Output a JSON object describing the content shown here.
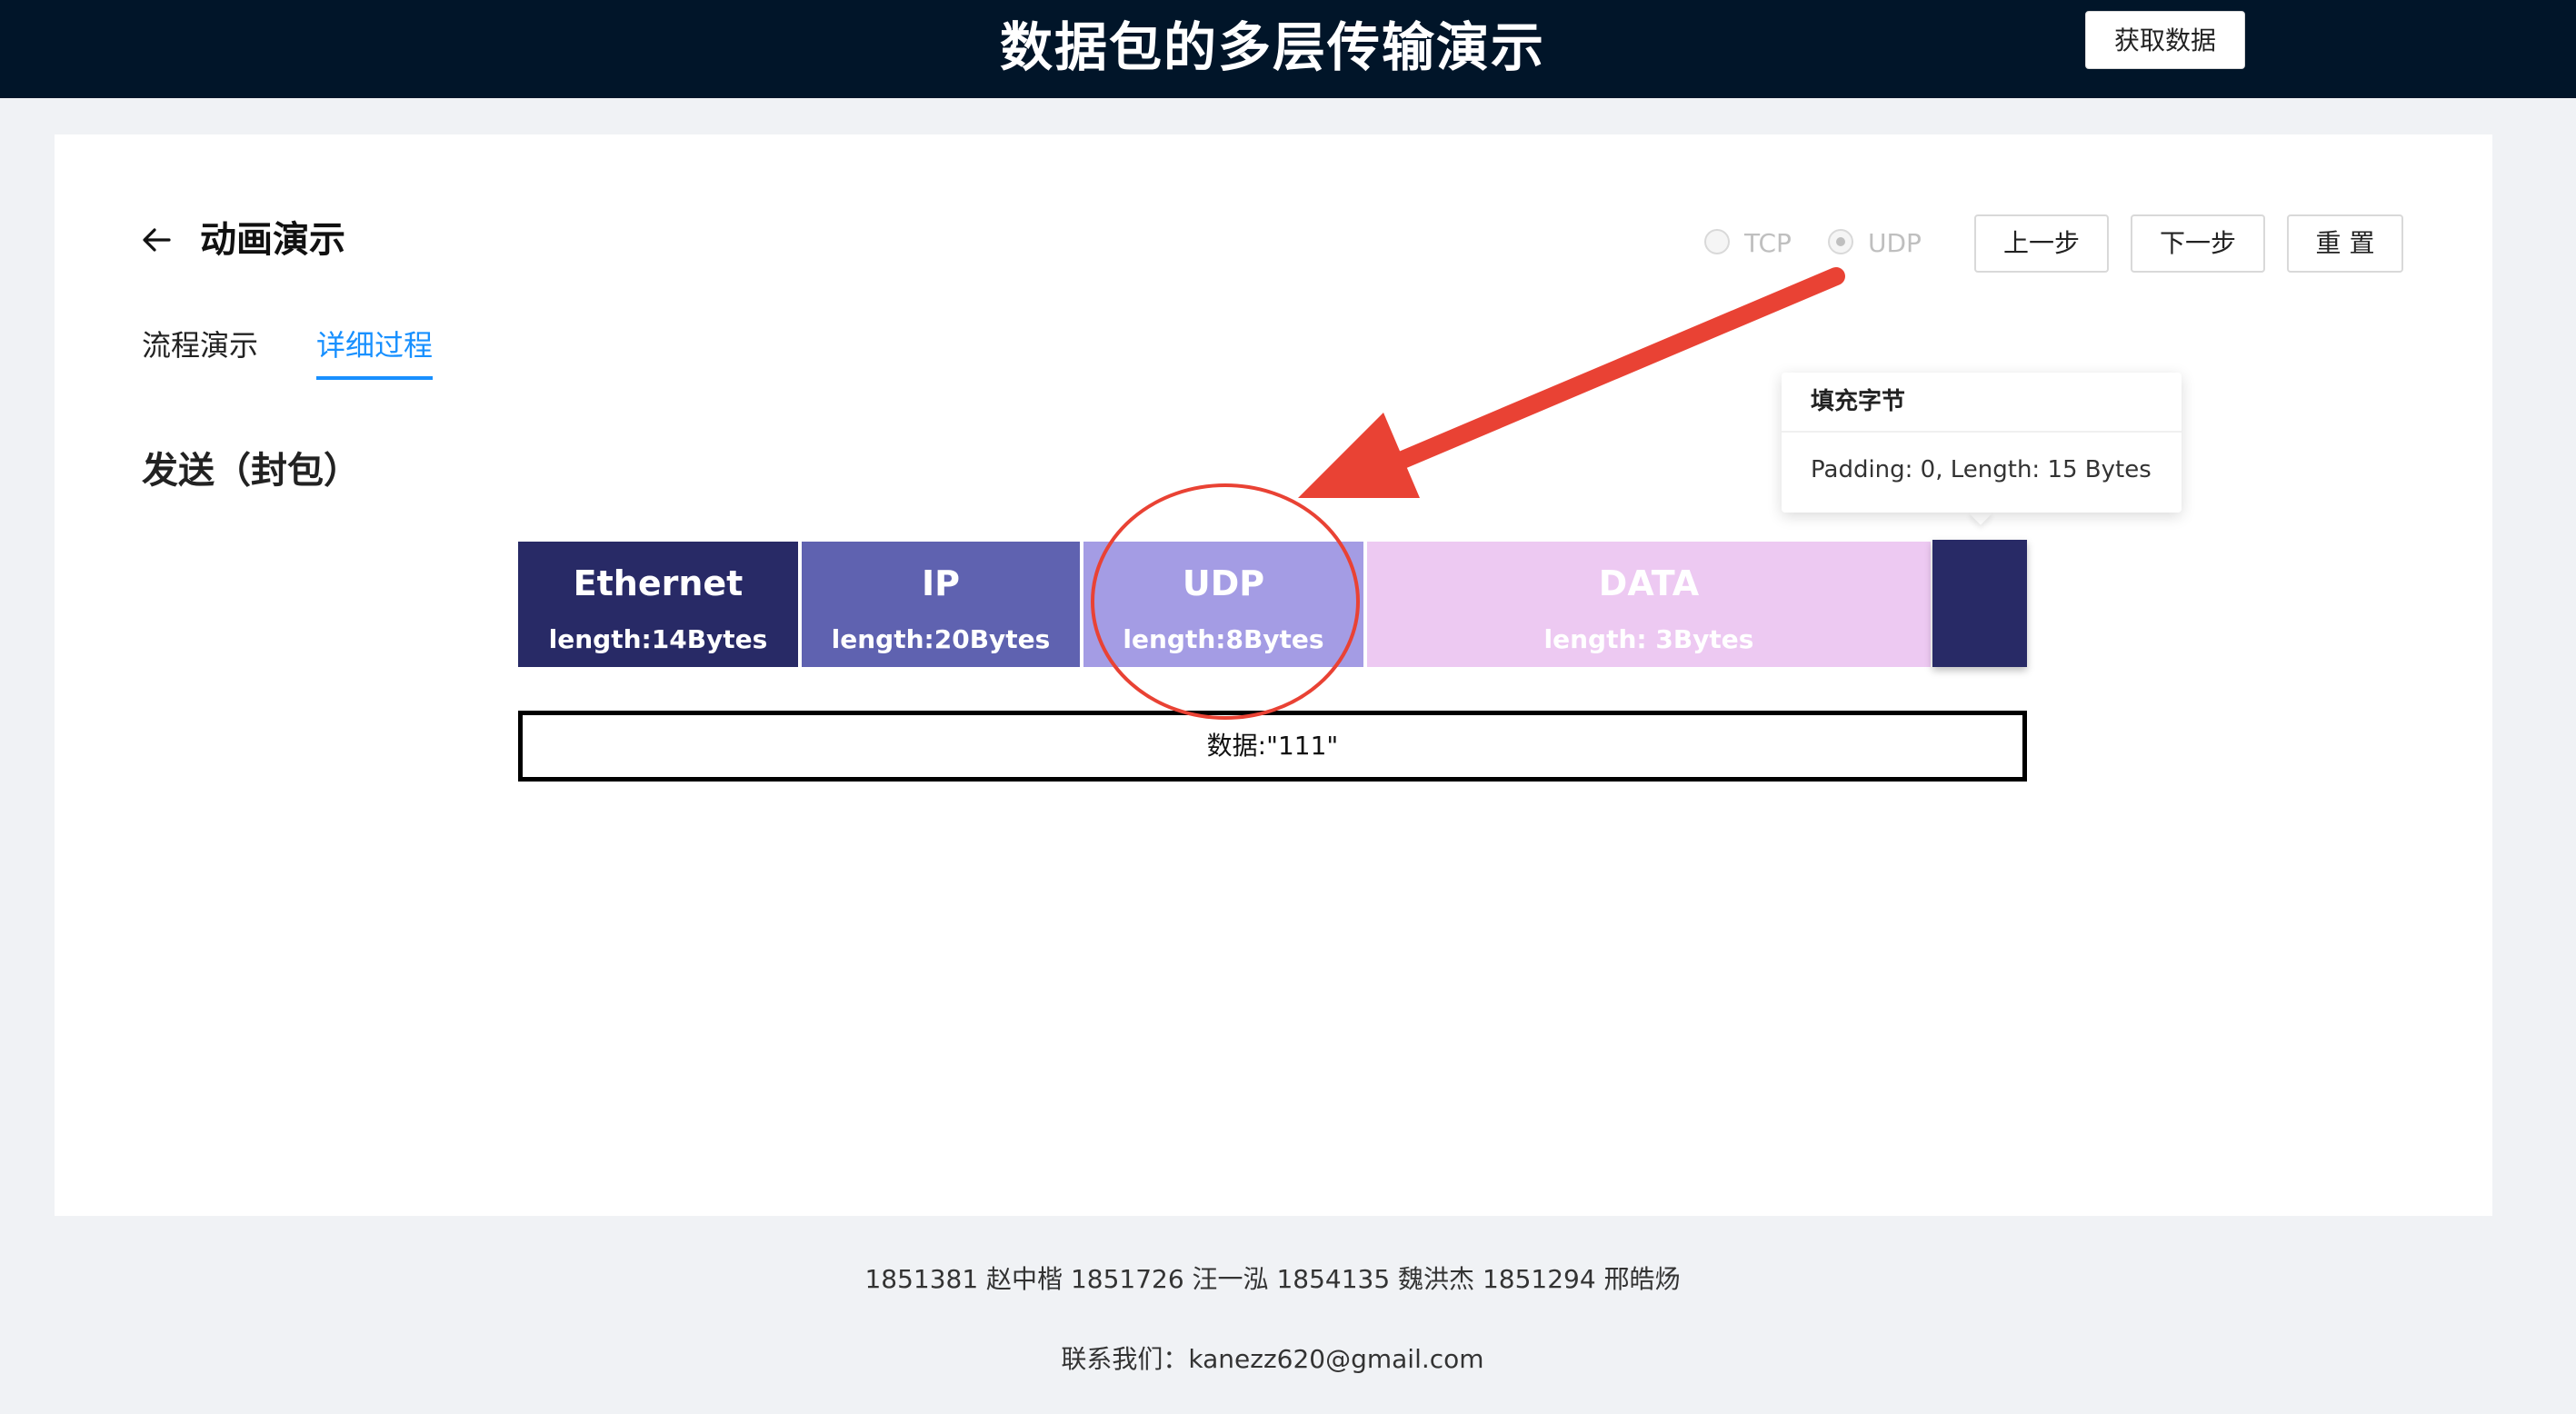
{
  "header": {
    "app_title": "数据包的多层传输演示",
    "fetch_button": "获取数据"
  },
  "card": {
    "title": "动画演示",
    "protocol_options": [
      {
        "label": "TCP",
        "selected": false
      },
      {
        "label": "UDP",
        "selected": true
      }
    ],
    "buttons": {
      "prev": "上一步",
      "next": "下一步",
      "reset": "重 置"
    },
    "tabs": [
      {
        "label": "流程演示",
        "active": false
      },
      {
        "label": "详细过程",
        "active": true
      }
    ],
    "section_title": "发送（封包）",
    "packet_segments": [
      {
        "name": "Ethernet",
        "length": "length:14Bytes",
        "color": "#282a66"
      },
      {
        "name": "IP",
        "length": "length:20Bytes",
        "color": "#5f62b0"
      },
      {
        "name": "UDP",
        "length": "length:8Bytes",
        "color": "#a49ce4"
      },
      {
        "name": "DATA",
        "length": "length: 3Bytes",
        "color": "#edc9f2"
      }
    ],
    "padding_color": "#282a66",
    "tooltip": {
      "title": "填充字节",
      "body": "Padding: 0, Length: 15 Bytes"
    },
    "data_box": "数据:\"111\"",
    "annotation_colors": {
      "arrow": "#e94234",
      "circle": "#e94234"
    }
  },
  "footer": {
    "members": "1851381 赵中楷 1851726 汪一泓 1854135 魏洪杰 1851294 邢皓炀",
    "contact": "联系我们：kanezz620@gmail.com"
  }
}
